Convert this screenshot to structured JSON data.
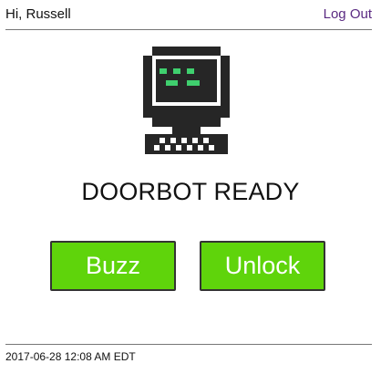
{
  "header": {
    "greeting": "Hi, Russell",
    "logout_label": "Log Out"
  },
  "main": {
    "robot_icon": "doorbot-computer-icon",
    "status_text": "DOORBOT READY",
    "buzz_label": "Buzz",
    "unlock_label": "Unlock"
  },
  "footer": {
    "timestamp": "2017-06-28 12:08 AM EDT"
  },
  "colors": {
    "button_green": "#5fd40b",
    "link_purple": "#5a2a82",
    "icon_dark": "#262626",
    "icon_screen_green": "#3fcf6e"
  }
}
